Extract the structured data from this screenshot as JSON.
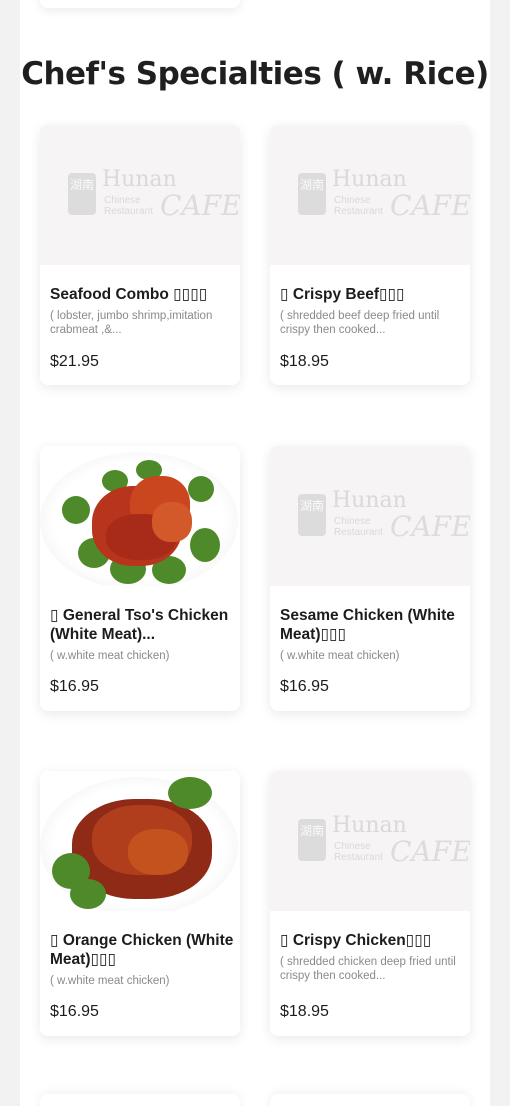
{
  "section": {
    "title": "Chef's Specialties ( w. Rice)"
  },
  "items": [
    {
      "name": "Seafood Combo ▯▯▯▯",
      "desc": "( lobster, jumbo shrimp,imitation crabmeat ,&...",
      "price": "$21.95",
      "image": "hunan-cafe-logo-placeholder"
    },
    {
      "name": "▯ Crispy Beef▯▯▯",
      "desc": "( shredded beef deep fried until crispy then cooked...",
      "price": "$18.95",
      "image": "hunan-cafe-logo-placeholder"
    },
    {
      "name": "▯ General Tso's Chicken (White Meat)...",
      "desc": "( w.white meat chicken)",
      "price": "$16.95",
      "image": "general-tso-chicken-photo"
    },
    {
      "name": "Sesame Chicken (White Meat)▯▯▯",
      "desc": "( w.white meat chicken)",
      "price": "$16.95",
      "image": "hunan-cafe-logo-placeholder"
    },
    {
      "name": "▯ Orange Chicken (White Meat)▯▯▯",
      "desc": "( w.white meat chicken)",
      "price": "$16.95",
      "image": "orange-chicken-photo"
    },
    {
      "name": "▯ Crispy Chicken▯▯▯",
      "desc": "( shredded chicken deep fried until crispy then cooked...",
      "price": "$18.95",
      "image": "hunan-cafe-logo-placeholder"
    }
  ],
  "logo": {
    "seal": "湖南",
    "word": "Hunan",
    "sub1": "Chinese",
    "sub2": "Restaurant",
    "cafe": "CAFE"
  },
  "colors": {
    "page_bg": "#f2f2f2",
    "card_bg": "#ffffff",
    "title": "#1f1f1f",
    "desc": "#8a8a8a"
  }
}
